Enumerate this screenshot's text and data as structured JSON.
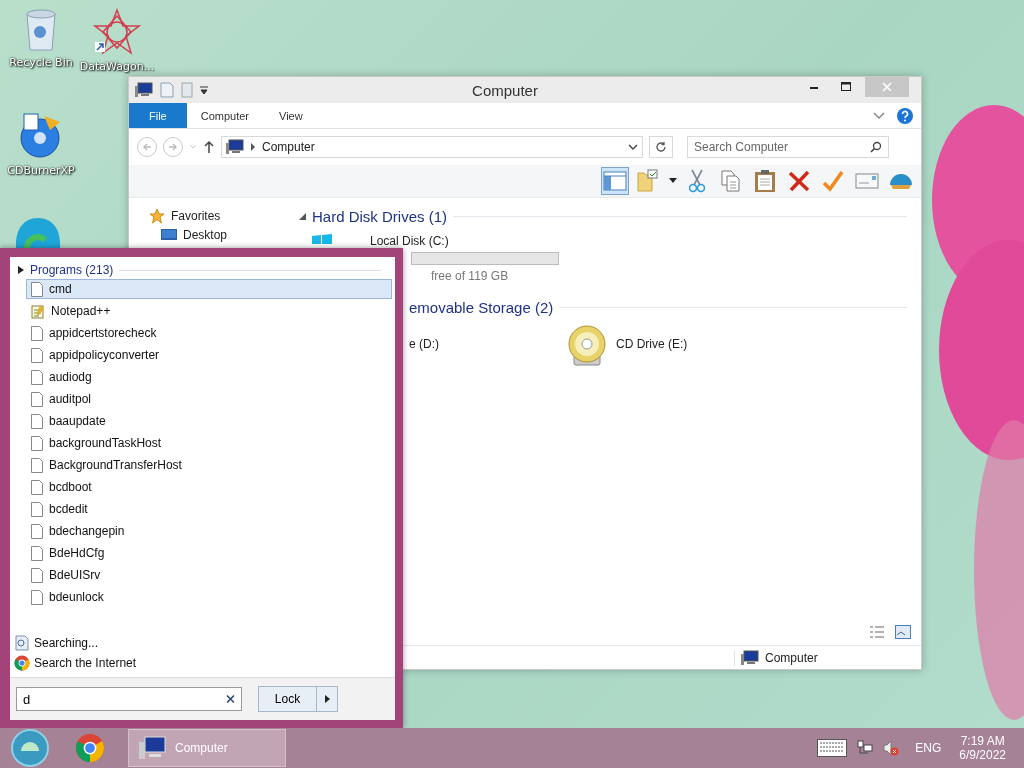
{
  "desktop_icons": [
    {
      "label": "Recycle Bin",
      "kind": "recycle"
    },
    {
      "label": "DataWagon...",
      "kind": "star"
    },
    {
      "label": "CDBurnerXP",
      "kind": "disc"
    }
  ],
  "window": {
    "title": "Computer",
    "ribbon_tabs": [
      {
        "label": "File",
        "selected": true
      },
      {
        "label": "Computer",
        "selected": false
      },
      {
        "label": "View",
        "selected": false
      }
    ],
    "address": {
      "path": "Computer"
    },
    "search": {
      "placeholder": "Search Computer"
    },
    "navigation": [
      {
        "label": "Favorites",
        "kind": "favorites"
      },
      {
        "label": "Desktop",
        "kind": "desktop"
      }
    ],
    "groups": [
      {
        "title": "Hard Disk Drives (1)",
        "items": [
          {
            "name": "Local Disk (C:)",
            "detail": "free of 119 GB",
            "kind": "disk"
          }
        ]
      },
      {
        "title": "emovable Storage (2)",
        "items": [
          {
            "name": "e (D:)",
            "kind": "covered"
          },
          {
            "name": "CD Drive (E:)",
            "kind": "cd"
          }
        ]
      }
    ],
    "status_bar": {
      "location": "Computer"
    }
  },
  "start_menu": {
    "section": "Programs (213)",
    "programs": [
      {
        "name": "cmd",
        "kind": "file",
        "selected": true
      },
      {
        "name": "Notepad++",
        "kind": "notepad",
        "selected": false
      },
      {
        "name": "appidcertstorecheck",
        "kind": "file",
        "selected": false
      },
      {
        "name": "appidpolicyconverter",
        "kind": "file",
        "selected": false
      },
      {
        "name": "audiodg",
        "kind": "file",
        "selected": false
      },
      {
        "name": "auditpol",
        "kind": "file",
        "selected": false
      },
      {
        "name": "baaupdate",
        "kind": "file",
        "selected": false
      },
      {
        "name": "backgroundTaskHost",
        "kind": "file",
        "selected": false
      },
      {
        "name": "BackgroundTransferHost",
        "kind": "file",
        "selected": false
      },
      {
        "name": "bcdboot",
        "kind": "file",
        "selected": false
      },
      {
        "name": "bcdedit",
        "kind": "file",
        "selected": false
      },
      {
        "name": "bdechangepin",
        "kind": "file",
        "selected": false
      },
      {
        "name": "BdeHdCfg",
        "kind": "file",
        "selected": false
      },
      {
        "name": "BdeUISrv",
        "kind": "file",
        "selected": false
      },
      {
        "name": "bdeunlock",
        "kind": "file",
        "selected": false
      }
    ],
    "links": [
      {
        "label": "Searching...",
        "kind": "search"
      },
      {
        "label": "Search the Internet",
        "kind": "browser"
      }
    ],
    "search": {
      "value": "d"
    },
    "power_button": {
      "label": "Lock"
    }
  },
  "taskbar": {
    "tasks": [
      {
        "label": "Computer"
      }
    ],
    "language": "ENG",
    "time": "7:19 AM",
    "date": "6/9/2022"
  }
}
